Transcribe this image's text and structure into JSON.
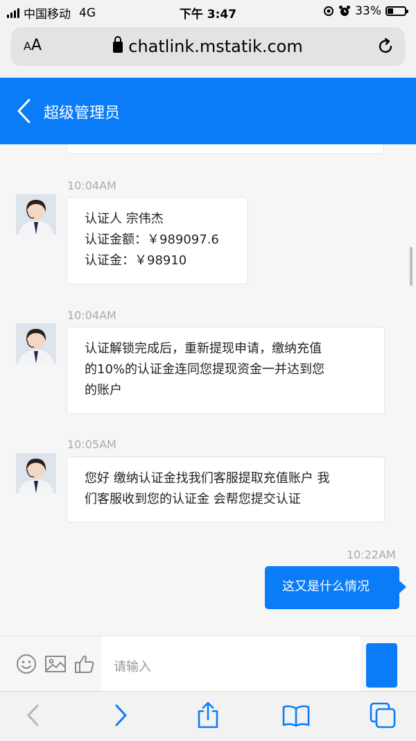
{
  "status_bar": {
    "carrier": "中国移动",
    "network": "4G",
    "time": "下午 3:47",
    "battery": "33%",
    "battery_level": 0.33
  },
  "browser": {
    "text_size_label": "AA",
    "url": "chatlink.mstatik.com"
  },
  "header": {
    "title": "超级管理员"
  },
  "messages": [
    {
      "timestamp": "10:04AM",
      "direction": "incoming",
      "lines": [
        "认证人 宗伟杰",
        "认证金额：￥989097.6",
        "认证金：￥98910"
      ]
    },
    {
      "timestamp": "10:04AM",
      "direction": "incoming",
      "lines": [
        "认证解锁完成后，重新提现申请，缴纳充值",
        "的10%的认证金连同您提现资金一并达到您",
        "的账户"
      ]
    },
    {
      "timestamp": "10:05AM",
      "direction": "incoming",
      "lines": [
        "您好 缴纳认证金找我们客服提取充值账户 我",
        "们客服收到您的认证金 会帮您提交认证"
      ]
    },
    {
      "timestamp": "10:22AM",
      "direction": "outgoing",
      "lines": [
        "这又是什么情况"
      ]
    }
  ],
  "input": {
    "placeholder": "请输入"
  },
  "colors": {
    "accent": "#0a7cf7"
  },
  "icons": {
    "input_bar": [
      "emoji-icon",
      "image-icon",
      "thumbs-up-icon"
    ],
    "toolbar": [
      "back-arrow-icon",
      "forward-arrow-icon",
      "share-icon",
      "bookmarks-icon",
      "tabs-icon"
    ]
  }
}
